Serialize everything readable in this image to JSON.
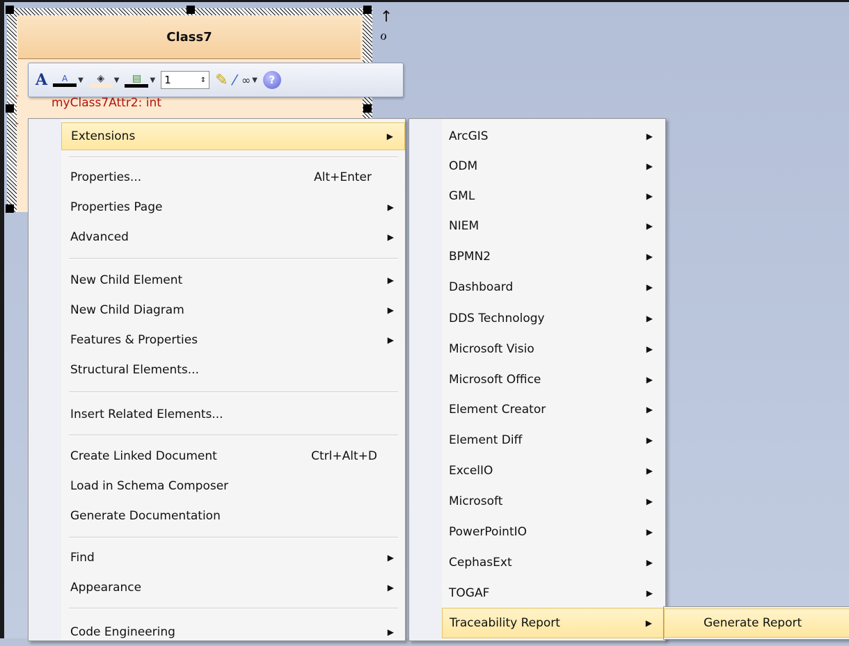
{
  "class_element": {
    "name": "Class7",
    "attributes": [
      "myClass7Attr2: int"
    ]
  },
  "side_icons": [
    "up-arrow-icon",
    "paint-icon"
  ],
  "toolbar": {
    "line_width": "1",
    "icons": [
      "font-icon",
      "font-color-icon",
      "fill-color-icon",
      "line-color-icon",
      "line-width-spinner",
      "format-painter-icon",
      "eyedropper-icon",
      "glasses-icon",
      "help-icon"
    ]
  },
  "context_menu": {
    "items": [
      {
        "label": "Extensions",
        "has_submenu": true,
        "highlighted": true
      },
      {
        "label": "Properties...",
        "shortcut": "Alt+Enter"
      },
      {
        "label": "Properties Page",
        "has_submenu": true
      },
      {
        "label": "Advanced",
        "has_submenu": true
      },
      {
        "label": "New Child Element",
        "has_submenu": true
      },
      {
        "label": "New Child Diagram",
        "has_submenu": true
      },
      {
        "label": "Features & Properties",
        "has_submenu": true
      },
      {
        "label": "Structural Elements..."
      },
      {
        "label": "Insert Related Elements..."
      },
      {
        "label": "Create Linked Document",
        "shortcut": "Ctrl+Alt+D"
      },
      {
        "label": "Load in Schema Composer"
      },
      {
        "label": "Generate Documentation"
      },
      {
        "label": "Find",
        "has_submenu": true
      },
      {
        "label": "Appearance",
        "has_submenu": true
      },
      {
        "label": "Code Engineering",
        "has_submenu": true
      }
    ]
  },
  "extensions_menu": {
    "items": [
      {
        "label": "ArcGIS"
      },
      {
        "label": "ODM"
      },
      {
        "label": "GML"
      },
      {
        "label": "NIEM"
      },
      {
        "label": "BPMN2"
      },
      {
        "label": "Dashboard"
      },
      {
        "label": "DDS Technology"
      },
      {
        "label": "Microsoft Visio"
      },
      {
        "label": "Microsoft Office"
      },
      {
        "label": "Element Creator"
      },
      {
        "label": "Element Diff"
      },
      {
        "label": "ExcelIO"
      },
      {
        "label": "Microsoft"
      },
      {
        "label": "PowerPointIO"
      },
      {
        "label": "CephasExt"
      },
      {
        "label": "TOGAF"
      },
      {
        "label": "Traceability Report",
        "highlighted": true
      }
    ]
  },
  "traceability_menu": {
    "items": [
      {
        "label": "Generate Report",
        "highlighted": true
      }
    ]
  },
  "colors": {
    "highlight": "#ffe7a1",
    "class_header": "#f6cf9c",
    "attribute_text": "#b3120e",
    "canvas": "#b8c3d9"
  }
}
